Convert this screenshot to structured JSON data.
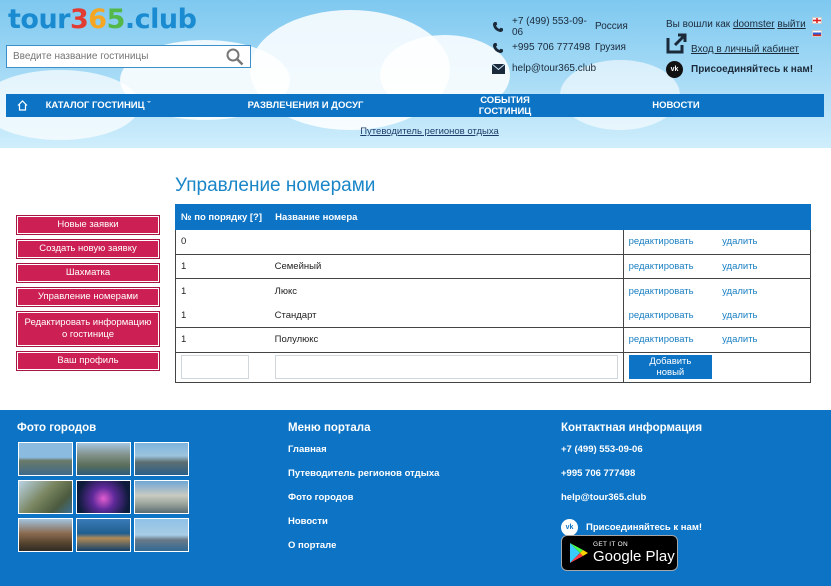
{
  "header": {
    "logo": {
      "part1": "tour",
      "d3": "3",
      "d6": "6",
      "d5": "5",
      "part2": ".club"
    },
    "search_placeholder": "Введите название гостиницы",
    "contacts": [
      {
        "icon": "phone-icon",
        "value": "+7 (499) 553-09-06",
        "country": "Россия"
      },
      {
        "icon": "phone-icon",
        "value": "+995 706 777498",
        "country": "Грузия"
      },
      {
        "icon": "mail-icon",
        "value": "help@tour365.club",
        "country": ""
      }
    ],
    "account": {
      "logged_prefix": "Вы вошли как",
      "username": "doomster",
      "logout": "выйти",
      "cabinet": "Вход в личный кабинет",
      "vk_join": "Присоединяйтесь к нам!"
    },
    "nav": [
      "КАТАЛОГ ГОСТИНИЦ ˇ",
      "РАЗВЛЕЧЕНИЯ И ДОСУГ",
      "СОБЫТИЯ ГОСТИНИЦ",
      "НОВОСТИ"
    ],
    "guide_link": "Путеводитель регионов отдыха"
  },
  "sidebar": {
    "items": [
      "Новые заявки",
      "Создать новую заявку",
      "Шахматка",
      "Управление номерами",
      "Редактировать информацию о гостинице",
      "Ваш профиль"
    ]
  },
  "main": {
    "title": "Управление номерами",
    "table": {
      "headers": [
        "№ по порядку [?]",
        "Название номера"
      ],
      "edit_label": "редактировать",
      "delete_label": "удалить",
      "rows": [
        {
          "order": "0",
          "name": ""
        },
        {
          "order": "1",
          "name": "Семейный"
        },
        {
          "order": "1",
          "name": "Люкс"
        },
        {
          "order": "1",
          "name": "Стандарт"
        },
        {
          "order": "1",
          "name": "Полулюкс"
        }
      ],
      "add_button": "Добавить новый"
    }
  },
  "footer": {
    "photos_title": "Фото городов",
    "menu_title": "Меню портала",
    "menu": [
      "Главная",
      "Путеводитель регионов отдыха",
      "Фото городов",
      "Новости",
      "О портале"
    ],
    "contact_title": "Контактная информация",
    "contacts": [
      "+7 (499) 553-09-06",
      "+995 706 777498",
      "help@tour365.club"
    ],
    "vk_join": "Присоединяйтесь к нам!",
    "gplay_small": "GET IT ON",
    "gplay_big": "Google Play"
  },
  "colors": {
    "brand_blue": "#0d74c5",
    "menu_red": "#cc2055",
    "title_blue": "#1a86c8"
  }
}
